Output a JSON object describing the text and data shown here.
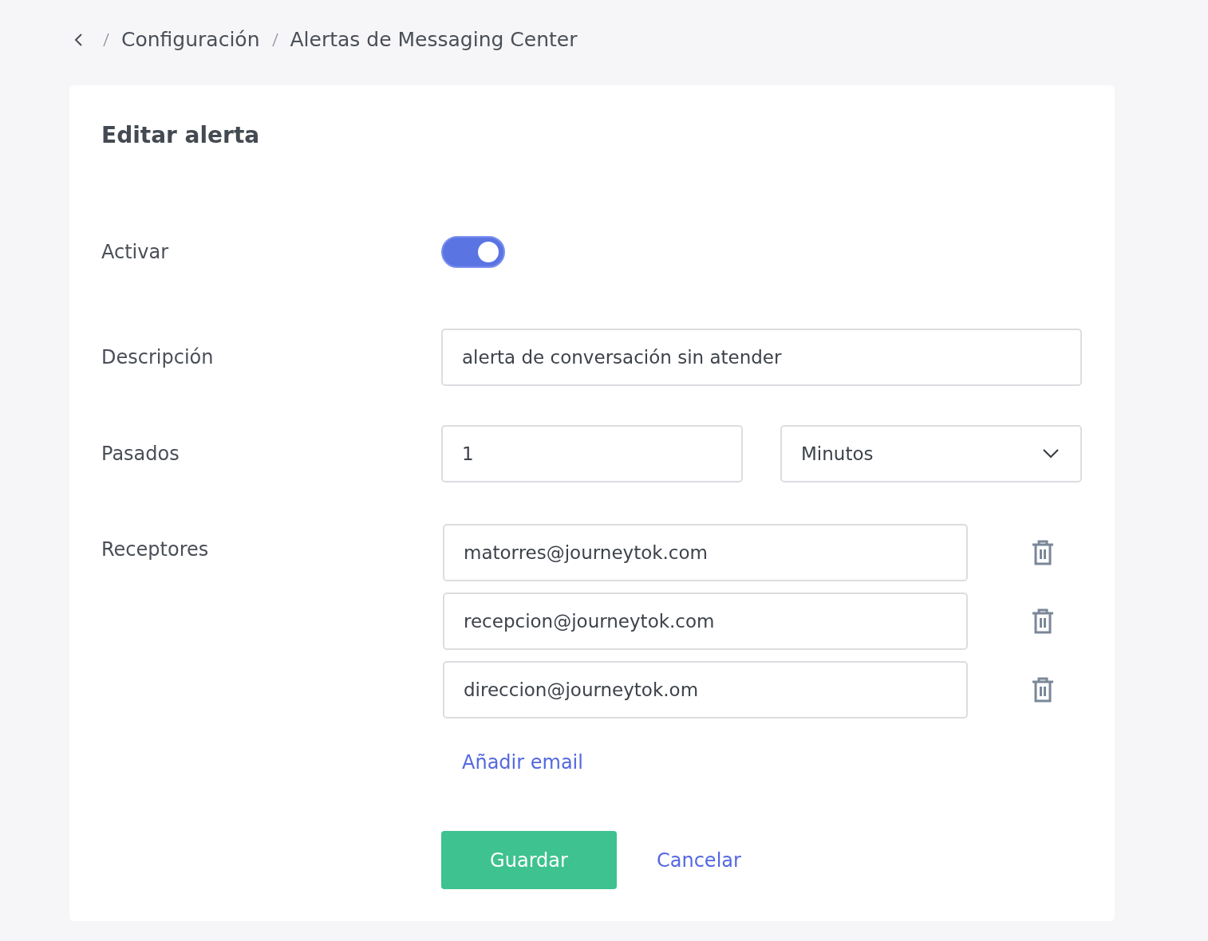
{
  "breadcrumb": {
    "items": [
      "Configuración",
      "Alertas de Messaging Center"
    ]
  },
  "form": {
    "title": "Editar alerta",
    "active": {
      "label": "Activar",
      "on": true
    },
    "description": {
      "label": "Descripción",
      "value": "alerta de conversación sin atender"
    },
    "elapsed": {
      "label": "Pasados",
      "value": "1",
      "unit": "Minutos"
    },
    "recipients": {
      "label": "Receptores",
      "emails": [
        "matorres@journeytok.com",
        "recepcion@journeytok.com",
        "direccion@journeytok.om"
      ],
      "add_link": "Añadir email"
    },
    "buttons": {
      "save": "Guardar",
      "cancel": "Cancelar"
    }
  }
}
